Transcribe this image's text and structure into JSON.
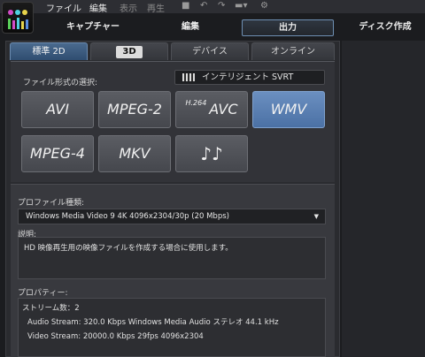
{
  "menu": {
    "file": "ファイル",
    "edit": "編集",
    "view": "表示",
    "play": "再生"
  },
  "main_tabs": {
    "capture": "キャプチャー",
    "edit": "編集",
    "output": "出力",
    "disc": "ディスク作成"
  },
  "sub_tabs": {
    "standard2d": "標準 2D",
    "three_d": "3D",
    "device": "デバイス",
    "online": "オンライン"
  },
  "format_section": {
    "label": "ファイル形式の選択:",
    "svrt_button": "インテリジェント SVRT",
    "formats": {
      "avi": "AVI",
      "mpeg2": "MPEG-2",
      "h264_sup": "H.264",
      "h264": "AVC",
      "wmv": "WMV",
      "mpeg4": "MPEG-4",
      "mkv": "MKV",
      "audio": "♪♪"
    },
    "selected": "WMV"
  },
  "profile": {
    "label": "プロファイル種類:",
    "value": "Windows Media Video 9 4K 4096x2304/30p (20 Mbps)"
  },
  "description": {
    "label": "説明:",
    "text": "HD 映像再生用の映像ファイルを作成する場合に使用します。"
  },
  "properties": {
    "label": "プロパティー:",
    "stream_count": "ストリーム数：2",
    "audio_stream": "Audio Stream:  320.0 Kbps  Windows Media Audio  ステレオ  44.1 kHz",
    "video_stream": "Video Stream:  20000.0 Kbps  29fps    4096x2304"
  },
  "colors": {
    "accent": "#4b71a5",
    "panel": "#2a2b2f",
    "background": "#1b1c1f"
  }
}
